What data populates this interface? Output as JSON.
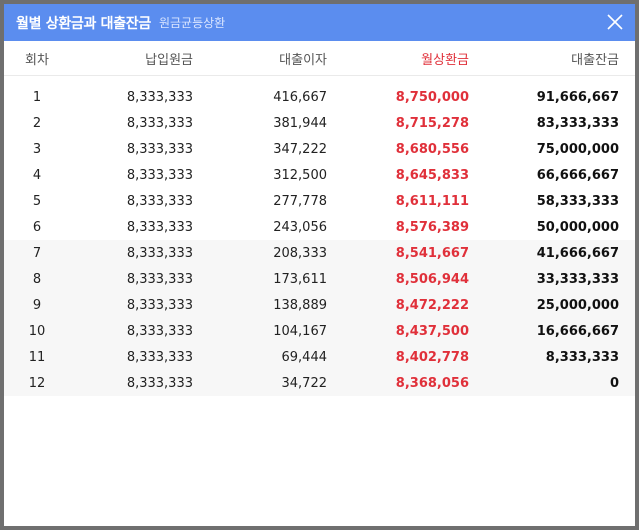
{
  "header": {
    "title": "월별 상환금과 대출잔금",
    "subtitle": "원금균등상환"
  },
  "columns": [
    "회차",
    "납입원금",
    "대출이자",
    "월상환금",
    "대출잔금"
  ],
  "rows": [
    [
      "1",
      "8,333,333",
      "416,667",
      "8,750,000",
      "91,666,667"
    ],
    [
      "2",
      "8,333,333",
      "381,944",
      "8,715,278",
      "83,333,333"
    ],
    [
      "3",
      "8,333,333",
      "347,222",
      "8,680,556",
      "75,000,000"
    ],
    [
      "4",
      "8,333,333",
      "312,500",
      "8,645,833",
      "66,666,667"
    ],
    [
      "5",
      "8,333,333",
      "277,778",
      "8,611,111",
      "58,333,333"
    ],
    [
      "6",
      "8,333,333",
      "243,056",
      "8,576,389",
      "50,000,000"
    ],
    [
      "7",
      "8,333,333",
      "208,333",
      "8,541,667",
      "41,666,667"
    ],
    [
      "8",
      "8,333,333",
      "173,611",
      "8,506,944",
      "33,333,333"
    ],
    [
      "9",
      "8,333,333",
      "138,889",
      "8,472,222",
      "25,000,000"
    ],
    [
      "10",
      "8,333,333",
      "104,167",
      "8,437,500",
      "16,666,667"
    ],
    [
      "11",
      "8,333,333",
      "69,444",
      "8,402,778",
      "8,333,333"
    ],
    [
      "12",
      "8,333,333",
      "34,722",
      "8,368,056",
      "0"
    ]
  ],
  "colors": {
    "header_bg": "#5b8def",
    "accent_red": "#e0303a"
  },
  "icons": {
    "close": "close-icon"
  }
}
